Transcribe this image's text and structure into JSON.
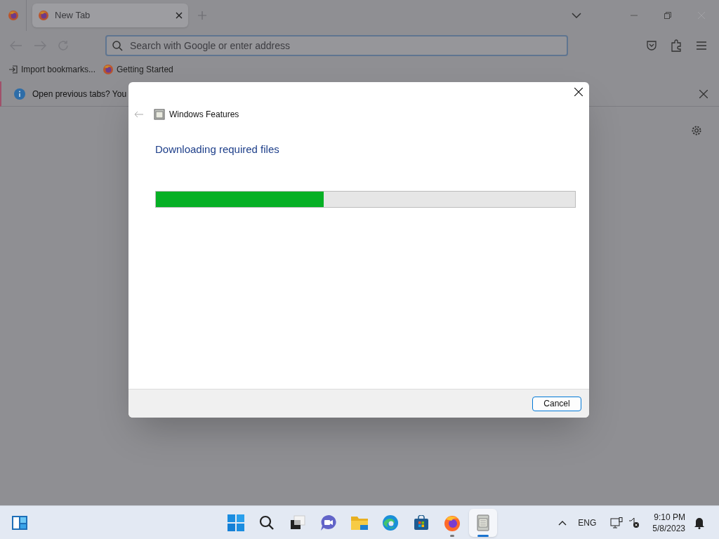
{
  "browser": {
    "tabs": [
      {
        "title": "New Tab",
        "selected": true
      }
    ],
    "address_bar": {
      "placeholder": "Search with Google or enter address"
    },
    "bookmarks": [
      {
        "kind": "import",
        "label": "Import bookmarks..."
      },
      {
        "kind": "site",
        "label": "Getting Started"
      }
    ],
    "notification": {
      "text": "Open previous tabs? You"
    }
  },
  "dialog": {
    "title": "Windows Features",
    "heading": "Downloading required files",
    "progress": {
      "level": 0.4
    },
    "buttons": [
      "Cancel"
    ]
  },
  "taskbar": {
    "apps": [
      {
        "kind": "start",
        "selected": false,
        "running": false
      },
      {
        "kind": "search",
        "selected": false,
        "running": false
      },
      {
        "kind": "taskview",
        "selected": false,
        "running": false
      },
      {
        "kind": "chat",
        "selected": false,
        "running": false
      },
      {
        "kind": "folder",
        "selected": false,
        "running": false
      },
      {
        "kind": "edge",
        "selected": false,
        "running": false
      },
      {
        "kind": "store",
        "selected": false,
        "running": false
      },
      {
        "kind": "firefox",
        "selected": false,
        "running": true
      },
      {
        "kind": "features",
        "selected": true,
        "running": true
      }
    ],
    "language": "ENG",
    "time": "9:10 PM",
    "date": "5/8/2023"
  }
}
